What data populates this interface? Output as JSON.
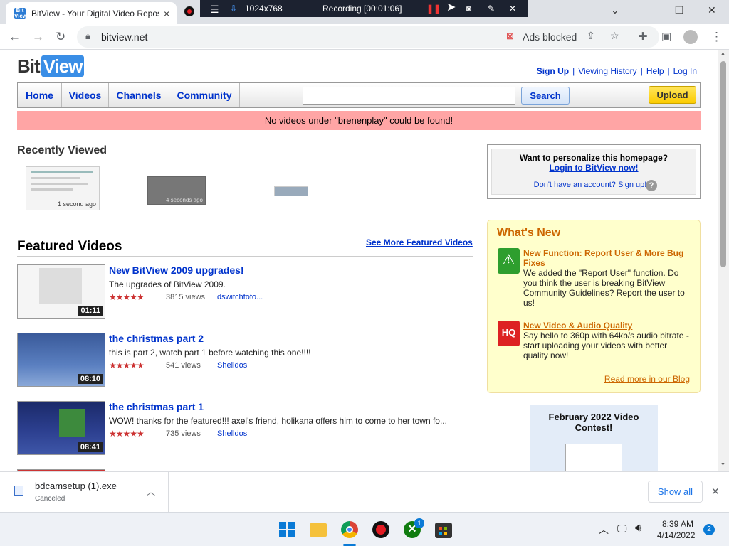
{
  "browser": {
    "tab_title": "BitView - Your Digital Video Repository",
    "tab_close": "×",
    "new_tab": "+",
    "address": "bitview.net",
    "ads_blocked": "Ads blocked",
    "window": {
      "minimize": "—",
      "maximize": "❐",
      "close": "✕",
      "tabsearch": "⌄"
    }
  },
  "recorder": {
    "resolution": "1024x768",
    "status": "Recording [00:01:06]"
  },
  "site": {
    "logo_bit": "Bit",
    "logo_view": "View",
    "top_links": [
      "Sign Up",
      "Viewing History",
      "Help",
      "Log In"
    ],
    "nav": [
      "Home",
      "Videos",
      "Channels",
      "Community"
    ],
    "search_value": "",
    "search_button": "Search",
    "upload_button": "Upload",
    "error_message": "No videos under \"brenenplay\" could be found!",
    "recently_viewed_heading": "Recently Viewed",
    "recently_viewed_times": [
      "1 second ago",
      "4 seconds ago"
    ],
    "featured_heading": "Featured Videos",
    "see_more": "See More Featured Videos",
    "videos": [
      {
        "title": "New BitView 2009 upgrades!",
        "desc": "The upgrades of BitView 2009.",
        "views": "3815 views",
        "user": "dswitchfofo...",
        "duration": "01:11",
        "stars": "★★★★★"
      },
      {
        "title": "the christmas part 2",
        "desc": "this is part 2, watch part 1 before watching this one!!!!",
        "views": "541 views",
        "user": "Shelldos",
        "duration": "08:10",
        "stars": "★★★★★"
      },
      {
        "title": "the christmas part 1",
        "desc": "WOW! thanks for the featured!!! axel's friend, holikana offers him to come to her town fo...",
        "views": "735 views",
        "user": "Shelldos",
        "duration": "08:41",
        "stars": "★★★★★"
      }
    ],
    "login_box": {
      "question": "Want to personalize this homepage?",
      "login_link": "Login to BitView now!",
      "signup_link": "Don't have an account? Sign up!",
      "help_icon": "?"
    },
    "whats_new": {
      "heading": "What's New",
      "items": [
        {
          "icon_text": "⚠",
          "title": "New Function: Report User & More Bug Fixes",
          "text": "We added the \"Report User\" function. Do you think the user is breaking BitView Community Guidelines? Report the user to us!"
        },
        {
          "icon_text": "HQ",
          "title": "New Video & Audio Quality",
          "text": "Say hello to 360p with 64kb/s audio bitrate - start uploading your videos with better quality now!"
        }
      ],
      "blog_link": "Read more in our Blog"
    },
    "contest": {
      "title": "February 2022 Video Contest!"
    }
  },
  "download_bar": {
    "filename": "bdcamsetup (1).exe",
    "status": "Canceled",
    "show_all": "Show all",
    "close": "✕"
  },
  "taskbar": {
    "time": "8:39 AM",
    "date": "4/14/2022",
    "notifications": "2",
    "xbox_badge": "1"
  },
  "colors": {
    "error_bg": "#ffa5a5",
    "link": "#0033cc",
    "whats_new_bg": "#ffffcc",
    "upload_yellow": "#fbcb00"
  }
}
